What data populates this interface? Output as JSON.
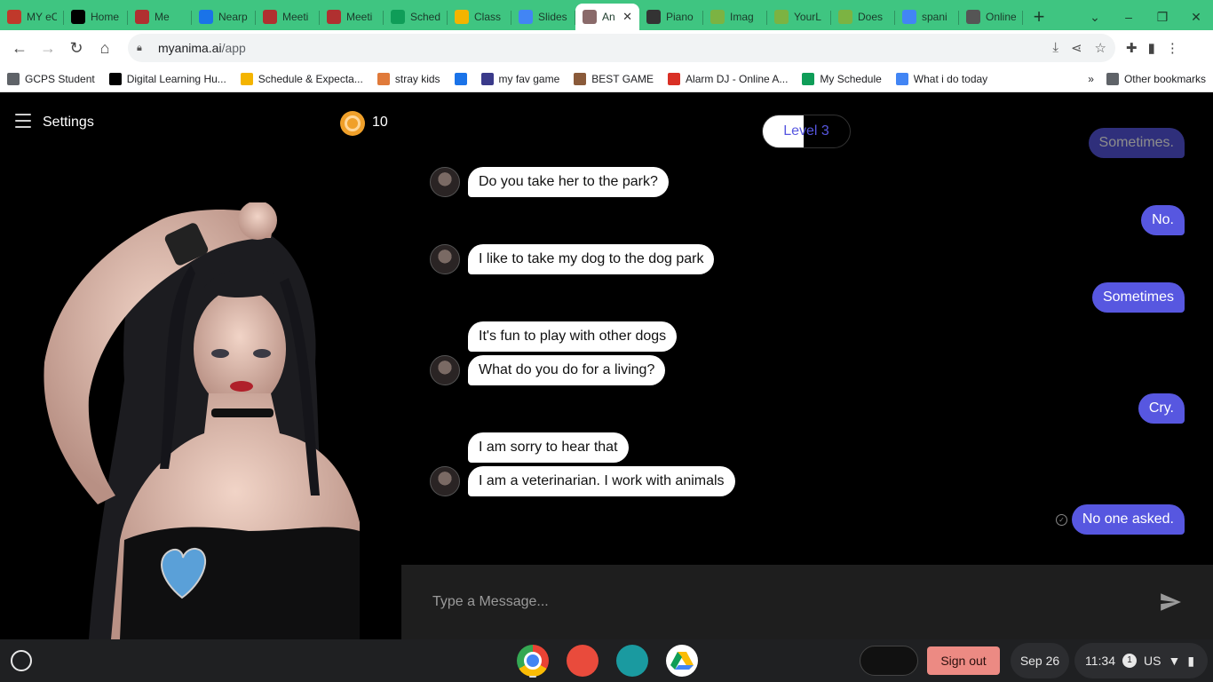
{
  "tabs": [
    {
      "title": "MY eC",
      "color": "#c0392b"
    },
    {
      "title": "Home",
      "color": "#000000"
    },
    {
      "title": "Me",
      "color": "#b03030"
    },
    {
      "title": "Nearp",
      "color": "#1a73e8"
    },
    {
      "title": "Meeti",
      "color": "#b03030"
    },
    {
      "title": "Meeti",
      "color": "#b03030"
    },
    {
      "title": "Sched",
      "color": "#0f9d58"
    },
    {
      "title": "Class",
      "color": "#f4b400"
    },
    {
      "title": "Slides",
      "color": "#4285f4"
    },
    {
      "title": "An",
      "color": "#8a6a6a",
      "active": true
    },
    {
      "title": "Piano",
      "color": "#333333"
    },
    {
      "title": "Imag",
      "color": "#7cb342"
    },
    {
      "title": "YourL",
      "color": "#7cb342"
    },
    {
      "title": "Does",
      "color": "#7cb342"
    },
    {
      "title": "spani",
      "color": "#4285f4"
    },
    {
      "title": "Online",
      "color": "#555555"
    }
  ],
  "toolbar": {
    "url_host": "myanima.ai",
    "url_path": "/app"
  },
  "bookmarks": [
    {
      "label": "GCPS Student",
      "color": "#5f6368"
    },
    {
      "label": "Digital Learning Hu...",
      "color": "#000000"
    },
    {
      "label": "Schedule & Expecta...",
      "color": "#f4b400"
    },
    {
      "label": "stray kids",
      "color": "#e07a3a"
    },
    {
      "label": "",
      "color": "#1a73e8"
    },
    {
      "label": "my fav game",
      "color": "#3a3a8a"
    },
    {
      "label": "BEST GAME",
      "color": "#8a5a3a"
    },
    {
      "label": "Alarm DJ - Online A...",
      "color": "#d93025"
    },
    {
      "label": "My Schedule",
      "color": "#0f9d58"
    },
    {
      "label": "What i do today",
      "color": "#4285f4"
    }
  ],
  "bookmarks_more": "Other bookmarks",
  "app": {
    "settings_label": "Settings",
    "coin_count": "10",
    "level_label": "Level 3",
    "composer_placeholder": "Type a Message..."
  },
  "messages": {
    "m0": "Sometimes.",
    "m1": "Do you take her to the park?",
    "m2": "No.",
    "m3": "I like to take my dog to the dog park",
    "m4": "Sometimes",
    "m5": "It's fun to play with other dogs",
    "m6": "What do you do for a living?",
    "m7": "Cry.",
    "m8": "I am sorry to hear that",
    "m9": "I am a veterinarian. I work with animals",
    "m10": "No one asked."
  },
  "shelf": {
    "sign_out": "Sign out",
    "date": "Sep 26",
    "time": "11:34",
    "notifications": "1",
    "locale": "US"
  }
}
